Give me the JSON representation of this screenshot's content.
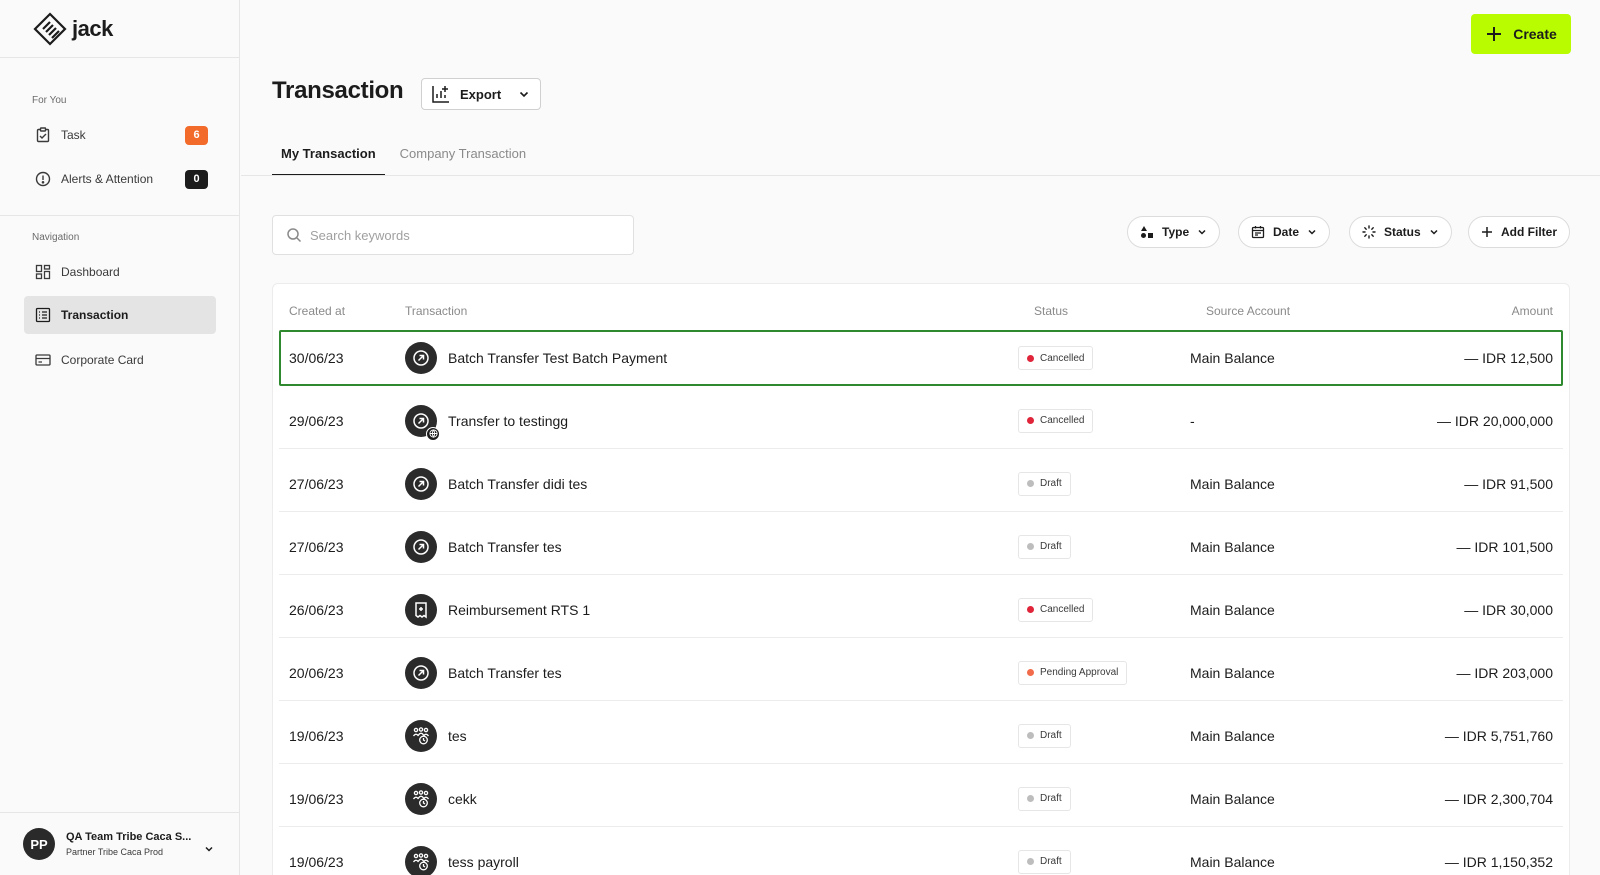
{
  "app": {
    "logo_text": "jack"
  },
  "colors": {
    "accent": "#b9fc00",
    "cancelled": "#e0253a",
    "draft": "#bdbdbd",
    "pending": "#f26b4a",
    "selected_border": "#2f8a2f"
  },
  "sidebar": {
    "for_you_label": "For You",
    "task": {
      "label": "Task",
      "badge": "6",
      "icon": "clipboard-check-icon"
    },
    "alerts": {
      "label": "Alerts & Attention",
      "badge": "0",
      "icon": "alert-circle-icon"
    },
    "navigation_label": "Navigation",
    "nav": [
      {
        "label": "Dashboard",
        "icon": "dashboard-icon",
        "active": false
      },
      {
        "label": "Transaction",
        "icon": "transaction-list-icon",
        "active": true
      },
      {
        "label": "Corporate Card",
        "icon": "card-icon",
        "active": false
      }
    ],
    "user": {
      "initials": "PP",
      "name": "QA Team Tribe Caca S...",
      "org": "Partner Tribe Caca Prod"
    }
  },
  "header": {
    "create_label": "Create",
    "title": "Transaction",
    "export_label": "Export"
  },
  "tabs": [
    {
      "label": "My Transaction",
      "active": true
    },
    {
      "label": "Company Transaction",
      "active": false
    }
  ],
  "search": {
    "placeholder": "Search keywords"
  },
  "filters": [
    {
      "label": "Type",
      "icon": "shapes-icon"
    },
    {
      "label": "Date",
      "icon": "calendar-icon"
    },
    {
      "label": "Status",
      "icon": "loader-icon"
    },
    {
      "label": "Add Filter",
      "icon": "plus-icon"
    }
  ],
  "table": {
    "columns": [
      "Created at",
      "Transaction",
      "Status",
      "Source Account",
      "Amount"
    ],
    "rows": [
      {
        "date": "30/06/23",
        "name": "Batch Transfer Test Batch Payment",
        "icon": "arrow-up-right-icon",
        "status": "Cancelled",
        "status_type": "cancelled",
        "source": "Main Balance",
        "amount": "— IDR 12,500",
        "selected": true
      },
      {
        "date": "29/06/23",
        "name": "Transfer to testingg",
        "icon": "arrow-up-right-icon",
        "globe": true,
        "status": "Cancelled",
        "status_type": "cancelled",
        "source": "-",
        "amount": "— IDR 20,000,000"
      },
      {
        "date": "27/06/23",
        "name": "Batch Transfer didi tes",
        "icon": "arrow-up-right-icon",
        "status": "Draft",
        "status_type": "draft",
        "source": "Main Balance",
        "amount": "— IDR 91,500"
      },
      {
        "date": "27/06/23",
        "name": "Batch Transfer tes",
        "icon": "arrow-up-right-icon",
        "status": "Draft",
        "status_type": "draft",
        "source": "Main Balance",
        "amount": "— IDR 101,500"
      },
      {
        "date": "26/06/23",
        "name": "Reimbursement RTS 1",
        "icon": "receipt-icon",
        "status": "Cancelled",
        "status_type": "cancelled",
        "source": "Main Balance",
        "amount": "— IDR 30,000"
      },
      {
        "date": "20/06/23",
        "name": "Batch Transfer tes",
        "icon": "arrow-up-right-icon",
        "status": "Pending Approval",
        "status_type": "pending",
        "source": "Main Balance",
        "amount": "— IDR 203,000"
      },
      {
        "date": "19/06/23",
        "name": "tes",
        "icon": "payroll-icon",
        "status": "Draft",
        "status_type": "draft",
        "source": "Main Balance",
        "amount": "— IDR 5,751,760"
      },
      {
        "date": "19/06/23",
        "name": "cekk",
        "icon": "payroll-icon",
        "status": "Draft",
        "status_type": "draft",
        "source": "Main Balance",
        "amount": "— IDR 2,300,704"
      },
      {
        "date": "19/06/23",
        "name": "tess payroll",
        "icon": "payroll-icon",
        "status": "Draft",
        "status_type": "draft",
        "source": "Main Balance",
        "amount": "— IDR 1,150,352"
      }
    ]
  }
}
